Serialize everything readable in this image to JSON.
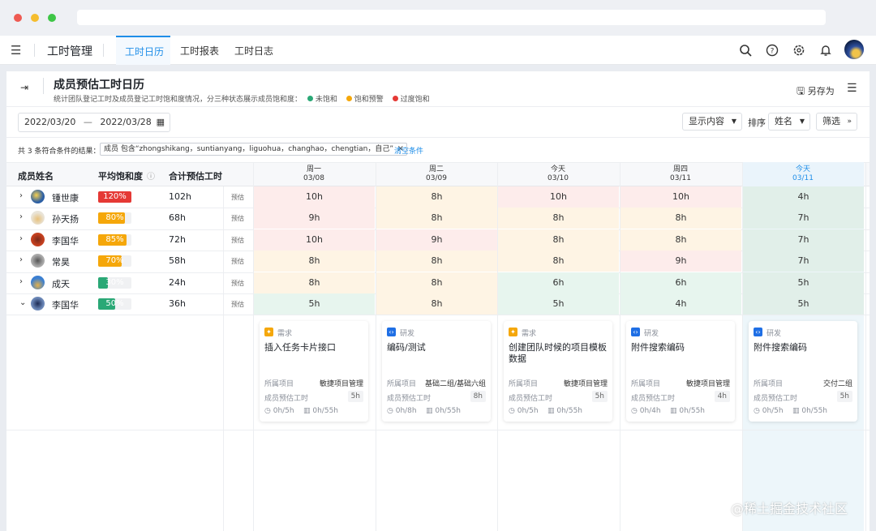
{
  "topbar": {
    "app_title": "工时管理",
    "tabs": [
      "工时日历",
      "工时报表",
      "工时日志"
    ]
  },
  "page": {
    "title": "成员预估工时日历",
    "desc": "统计团队登记工时及成员登记工时饱和度情况，分三种状态展示成员饱和度：",
    "legend": [
      {
        "label": "未饱和",
        "color": "#2aa876"
      },
      {
        "label": "饱和预警",
        "color": "#f5a70a"
      },
      {
        "label": "过度饱和",
        "color": "#e53935"
      }
    ],
    "save_as": "另存为"
  },
  "toolbar": {
    "date_start": "2022/03/20",
    "date_sep": "—",
    "date_end": "2022/03/28",
    "display_btn": "显示内容",
    "sort_label": "排序",
    "sort_value": "姓名",
    "filter_btn": "筛选"
  },
  "filter": {
    "result_text": "共 3 条符合条件的结果：",
    "tag": "成员 包含“zhongshikang，suntianyang，liguohua，changhao，chengtian，自己”",
    "clear": "清空条件"
  },
  "table": {
    "headers": {
      "name": "成员姓名",
      "avg": "平均饱和度",
      "total": "合计预估工时"
    },
    "est_label": "预估",
    "days": [
      {
        "week": "周一",
        "date": "03/08"
      },
      {
        "week": "周二",
        "date": "03/09"
      },
      {
        "week": "今天",
        "date": "03/10"
      },
      {
        "week": "周四",
        "date": "03/11"
      },
      {
        "week": "今天",
        "date": "03/11"
      }
    ],
    "rows": [
      {
        "name": "锺世康",
        "pct": "120%",
        "level": "over",
        "total": "102h",
        "hours": [
          "10h",
          "8h",
          "10h",
          "10h",
          "4h"
        ]
      },
      {
        "name": "孙天扬",
        "pct": "80%",
        "level": "warn",
        "total": "68h",
        "hours": [
          "9h",
          "8h",
          "8h",
          "8h",
          "7h"
        ]
      },
      {
        "name": "李国华",
        "pct": "85%",
        "level": "warn",
        "total": "72h",
        "hours": [
          "10h",
          "9h",
          "8h",
          "8h",
          "7h"
        ]
      },
      {
        "name": "常昊",
        "pct": "70%",
        "level": "warn",
        "total": "58h",
        "hours": [
          "8h",
          "8h",
          "8h",
          "9h",
          "7h"
        ]
      },
      {
        "name": "成天",
        "pct": "30%",
        "level": "ok",
        "total": "24h",
        "hours": [
          "8h",
          "8h",
          "6h",
          "6h",
          "5h"
        ]
      },
      {
        "name": "李国华",
        "pct": "50%",
        "level": "ok",
        "total": "36h",
        "hours": [
          "5h",
          "8h",
          "5h",
          "4h",
          "5h"
        ]
      }
    ]
  },
  "cards": [
    {
      "type": "需求",
      "type_icon": "lightbulb",
      "title": "插入任务卡片接口",
      "project_label": "所属项目",
      "project": "敏捷项目管理",
      "est_label": "成员预估工时",
      "est": "5h",
      "logged": "0h/5h",
      "actual": "0h/55h"
    },
    {
      "type": "研发",
      "type_icon": "code",
      "title": "编码/测试",
      "project_label": "所属项目",
      "project": "基础二组/基础六组",
      "est_label": "成员预估工时",
      "est": "8h",
      "logged": "0h/8h",
      "actual": "0h/55h"
    },
    {
      "type": "需求",
      "type_icon": "lightbulb",
      "title": "创建团队时候的项目模板数据",
      "project_label": "所属项目",
      "project": "敏捷项目管理",
      "est_label": "成员预估工时",
      "est": "5h",
      "logged": "0h/5h",
      "actual": "0h/55h"
    },
    {
      "type": "研发",
      "type_icon": "code",
      "title": "附件搜索编码",
      "project_label": "所属项目",
      "project": "敏捷项目管理",
      "est_label": "成员预估工时",
      "est": "4h",
      "logged": "0h/4h",
      "actual": "0h/55h"
    },
    {
      "type": "研发",
      "type_icon": "code",
      "title": "附件搜索编码",
      "project_label": "所属项目",
      "project": "交付二组",
      "est_label": "成员预估工时",
      "est": "5h",
      "logged": "0h/5h",
      "actual": "0h/55h"
    }
  ],
  "watermark": "@稀土掘金技术社区",
  "colors": {
    "accent": "#1f8ee8",
    "over": "#e53935",
    "warn": "#f5a70a",
    "ok": "#2aa876"
  }
}
